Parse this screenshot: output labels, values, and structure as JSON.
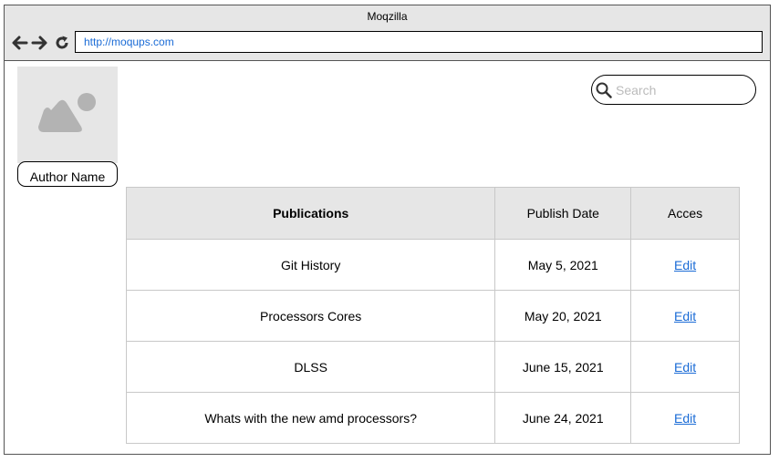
{
  "browser": {
    "title": "Moqzilla",
    "url": "http://moqups.com"
  },
  "profile": {
    "author_name": "Author Name"
  },
  "search": {
    "placeholder": "Search"
  },
  "table": {
    "headers": [
      "Publications",
      "Publish Date",
      "Acces"
    ],
    "rows": [
      {
        "title": "Git History",
        "date": "May 5, 2021",
        "action": "Edit"
      },
      {
        "title": "Processors Cores",
        "date": "May 20, 2021",
        "action": "Edit"
      },
      {
        "title": "DLSS",
        "date": "June 15, 2021",
        "action": "Edit"
      },
      {
        "title": "Whats with the new amd processors?",
        "date": "June 24, 2021",
        "action": "Edit"
      }
    ]
  },
  "colors": {
    "chrome_bg": "#e6e6e6",
    "link": "#1a6bd6",
    "border": "#555555"
  },
  "icons": [
    "back-arrow-icon",
    "forward-arrow-icon",
    "reload-icon",
    "image-placeholder-icon",
    "search-icon"
  ]
}
